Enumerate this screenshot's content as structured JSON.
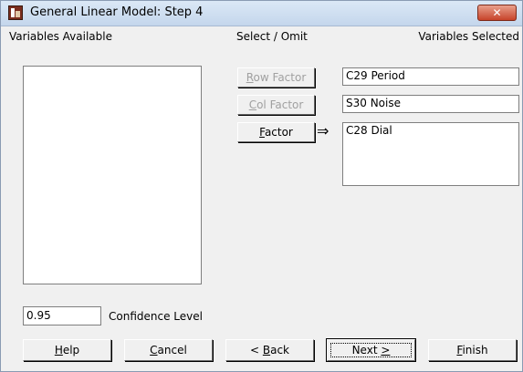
{
  "window": {
    "title": "General Linear Model: Step 4",
    "close_glyph": "✕"
  },
  "labels": {
    "variables_available": "Variables Available",
    "select_omit": "Select / Omit",
    "variables_selected": "Variables Selected",
    "confidence_level": "Confidence Level"
  },
  "select_buttons": {
    "row_factor": {
      "accel": "R",
      "rest": "ow Factor",
      "enabled": false
    },
    "col_factor": {
      "accel": "C",
      "rest": "ol Factor",
      "enabled": false
    },
    "factor": {
      "accel": "F",
      "rest": "actor",
      "enabled": true
    }
  },
  "selected": {
    "row_factor_value": "C29 Period",
    "col_factor_value": "S30 Noise",
    "factor_items": [
      "C28 Dial"
    ]
  },
  "confidence_value": "0.95",
  "arrow_glyph": "⇒",
  "footer_buttons": {
    "help": {
      "accel": "H",
      "rest": "elp"
    },
    "cancel": {
      "accel": "C",
      "rest": "ancel"
    },
    "back": {
      "prefix": "< ",
      "accel": "B",
      "rest": "ack"
    },
    "next": {
      "prefix": "Next ",
      "accel": ">",
      "rest": ""
    },
    "finish": {
      "accel": "F",
      "rest": "inish"
    }
  }
}
